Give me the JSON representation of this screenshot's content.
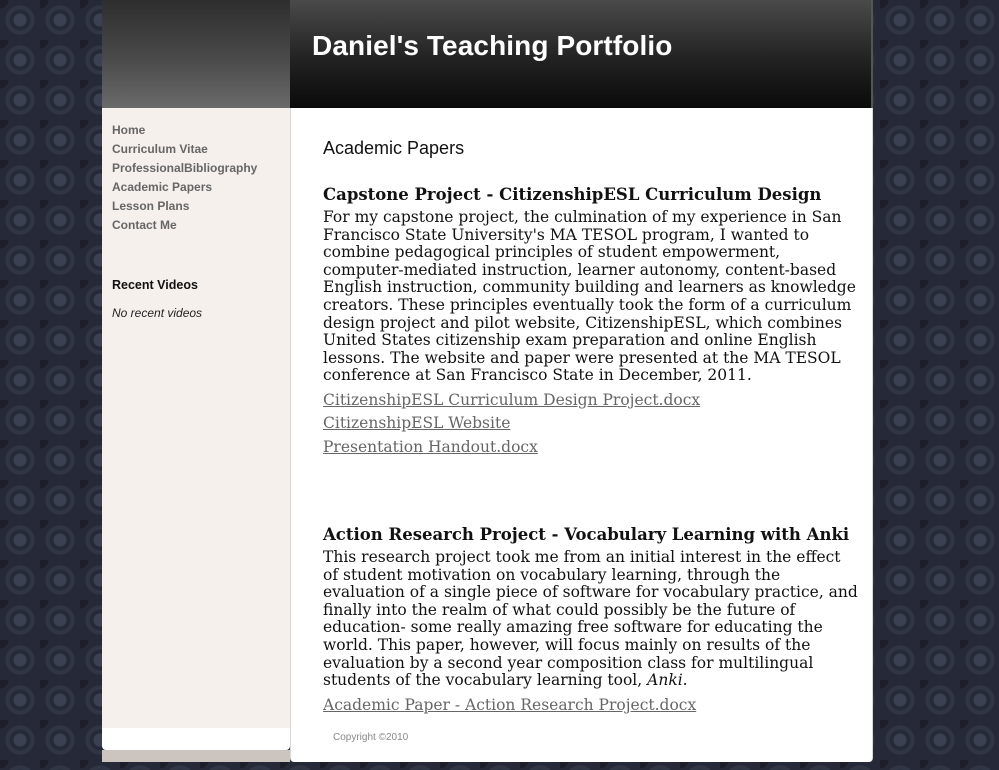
{
  "site": {
    "title": "Daniel's Teaching Portfolio"
  },
  "nav": {
    "items": [
      {
        "label": "Home"
      },
      {
        "label": "Curriculum Vitae"
      },
      {
        "label": "ProfessionalBibliography"
      },
      {
        "label": "Academic Papers"
      },
      {
        "label": "Lesson Plans"
      },
      {
        "label": "Contact Me"
      }
    ]
  },
  "recent_videos": {
    "title": "Recent Videos",
    "empty_text": "No recent videos"
  },
  "main": {
    "heading": "Academic Papers",
    "sections": [
      {
        "title": "Capstone Project - CitizenshipESL Curriculum Design",
        "body": "For my capstone project, the culmination of my experience in San Francisco State University's MA TESOL program, I wanted to combine pedagogical principles of student empowerment, computer-mediated instruction, learner autonomy, content-based English instruction, community building and learners as knowledge creators.  These principles eventually took the form of a curriculum design project and pilot website, CitizenshipESL, which combines United States citizenship exam preparation and online English lessons.  The website and paper were presented at the MA TESOL conference at San Francisco State in December, 2011.",
        "links": [
          "CitizenshipESL Curriculum Design Project.docx",
          "CitizenshipESL Website",
          "Presentation Handout.docx"
        ]
      },
      {
        "title": "Action Research Project - Vocabulary Learning with Anki",
        "body": "This research project took me from an initial interest in the effect of student motivation on vocabulary learning, through the evaluation of a single piece of software for vocabulary practice, and finally into the realm of what could possibly be the future of education- some really amazing free software for educating the world.  This paper, however, will focus mainly on results of the evaluation by a second year composition class for multilingual students of the vocabulary learning tool,",
        "body_emphasis": "Anki",
        "body_end": ".",
        "links": [
          "Academic Paper - Action Research Project.docx"
        ]
      }
    ]
  },
  "footer": {
    "copyright": "Copyright ©2010"
  }
}
